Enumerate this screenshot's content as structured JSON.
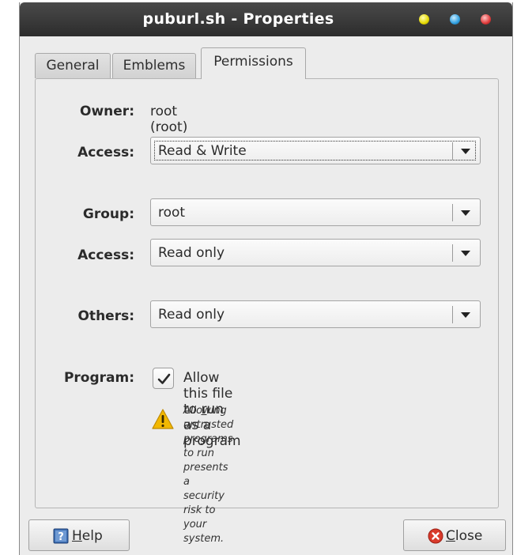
{
  "window": {
    "title": "puburl.sh - Properties"
  },
  "tabs": [
    {
      "label": "General"
    },
    {
      "label": "Emblems"
    },
    {
      "label": "Permissions"
    }
  ],
  "permissions": {
    "owner_label": "Owner:",
    "owner_value": "root (root)",
    "owner_access_label": "Access:",
    "owner_access_value": "Read & Write",
    "group_label": "Group:",
    "group_value": "root",
    "group_access_label": "Access:",
    "group_access_value": "Read only",
    "others_label": "Others:",
    "others_value": "Read only",
    "program_label": "Program:",
    "program_checked": true,
    "program_check_pre": "Allow this file to ",
    "program_check_mnemonic": "r",
    "program_check_post": "un as a program",
    "warning_line1": "Allowing untrusted programs to run",
    "warning_line2": "presents a security risk to your system."
  },
  "buttons": {
    "help_mnemonic": "H",
    "help_rest": "elp",
    "close_mnemonic": "C",
    "close_rest": "lose"
  },
  "icons": {
    "help": "help-book-icon",
    "close": "close-circle-icon",
    "warning": "warning-triangle-icon",
    "combo_arrow": "chevron-down-icon",
    "check": "checkmark-icon"
  },
  "colors": {
    "titlebar": "#2c2c2c",
    "minimize": "#e4d800",
    "maximize": "#2f9fe0",
    "close": "#e03a3a",
    "warning": "#f2b800",
    "close_icon": "#d93a2b"
  }
}
